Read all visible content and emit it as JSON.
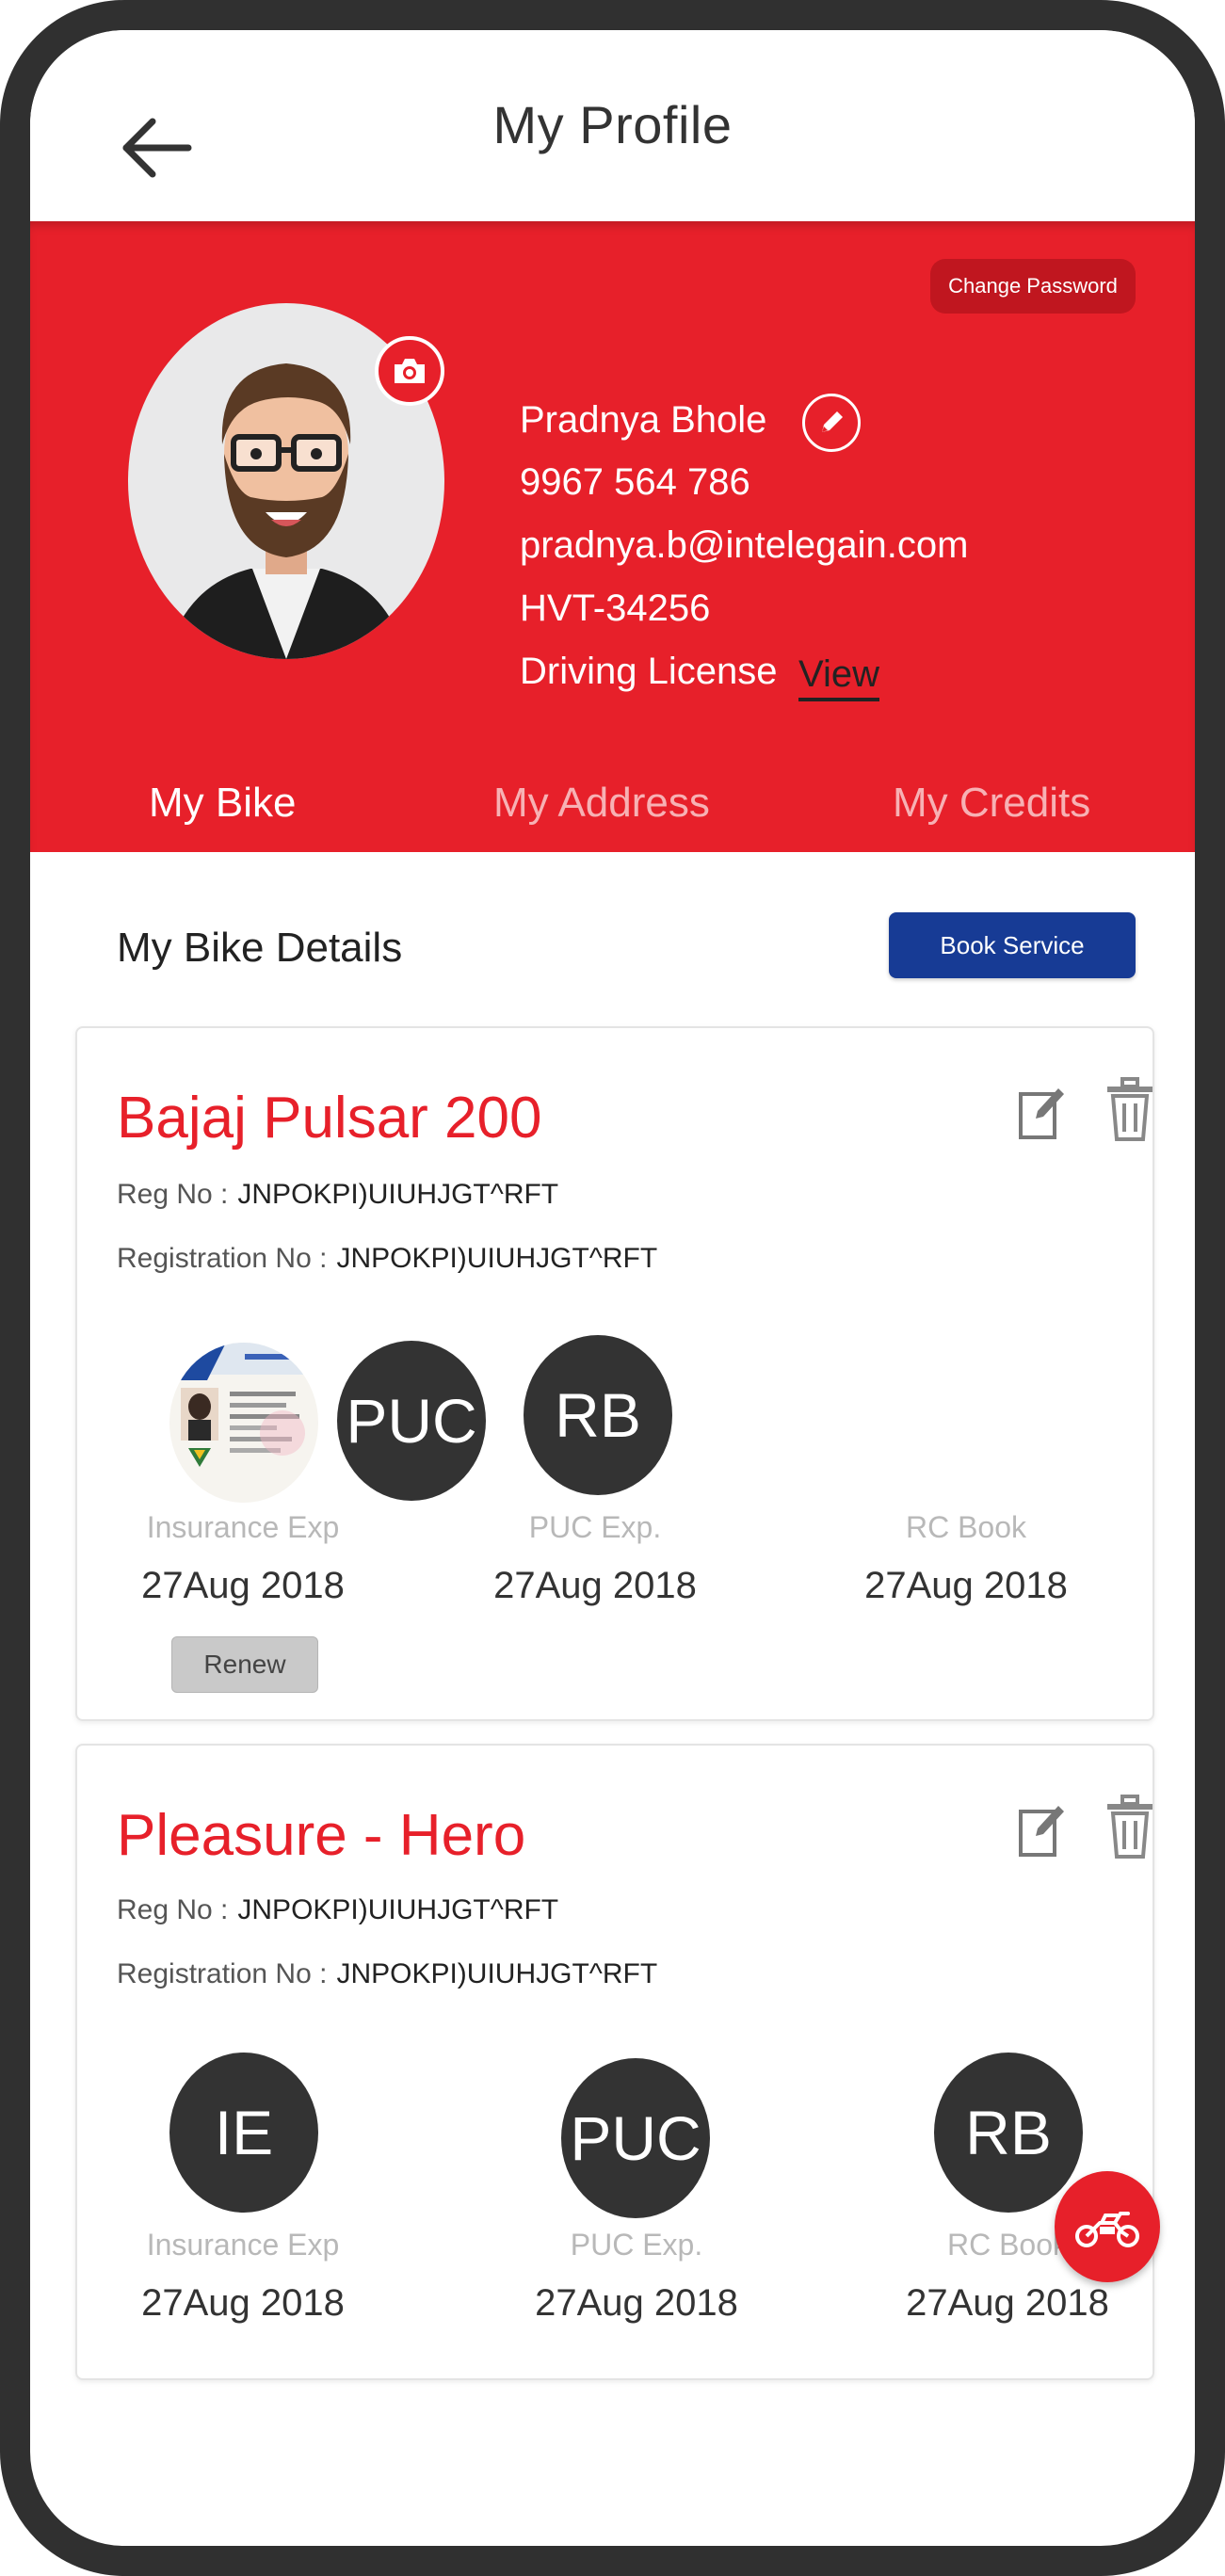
{
  "header": {
    "title": "My Profile"
  },
  "profile": {
    "change_password_label": "Change Password",
    "name": "Pradnya Bhole",
    "phone": "9967 564 786",
    "email": "pradnya.b@intelegain.com",
    "id": "HVT-34256",
    "license_label": "Driving License",
    "license_link": "View"
  },
  "tabs": [
    {
      "label": "My Bike",
      "active": true
    },
    {
      "label": "My Address",
      "active": false
    },
    {
      "label": "My Credits",
      "active": false
    }
  ],
  "section": {
    "title": "My Bike Details",
    "book_service_label": "Book Service"
  },
  "bikes": [
    {
      "name": "Bajaj Pulsar 200",
      "reg_no_label": "Reg No :",
      "reg_no": "JNPOKPI)UIUHJGT^RFT",
      "registration_no_label": "Registration No :",
      "registration_no": "JNPOKPI)UIUHJGT^RFT",
      "docs": [
        {
          "badge": "",
          "label": "Insurance Exp",
          "date": "27Aug 2018"
        },
        {
          "badge": "PUC",
          "label": "PUC Exp.",
          "date": "27Aug 2018"
        },
        {
          "badge": "RB",
          "label": "RC Book",
          "date": "27Aug 2018"
        }
      ],
      "renew_label": "Renew"
    },
    {
      "name": "Pleasure - Hero",
      "reg_no_label": "Reg No :",
      "reg_no": "JNPOKPI)UIUHJGT^RFT",
      "registration_no_label": "Registration No :",
      "registration_no": "JNPOKPI)UIUHJGT^RFT",
      "docs": [
        {
          "badge": "IE",
          "label": "Insurance Exp",
          "date": "27Aug 2018"
        },
        {
          "badge": "PUC",
          "label": "PUC Exp.",
          "date": "27Aug 2018"
        },
        {
          "badge": "RB",
          "label": "RC Book",
          "date": "27Aug 2018"
        }
      ]
    }
  ],
  "colors": {
    "primary": "#e7202a",
    "book_service": "#173b95",
    "badge": "#333333"
  },
  "icons": {
    "back": "arrow-left-icon",
    "camera": "camera-icon",
    "edit": "pencil-icon",
    "card_edit": "edit-icon",
    "card_delete": "trash-icon",
    "fab": "motorcycle-icon"
  }
}
